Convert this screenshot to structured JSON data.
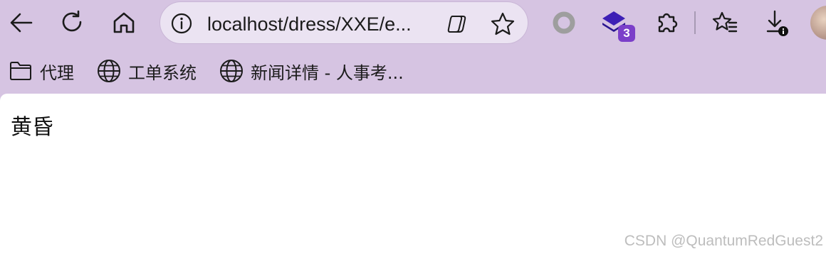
{
  "toolbar": {
    "back": "back-arrow-icon",
    "refresh": "refresh-icon",
    "home": "home-icon",
    "address": {
      "url": "localhost/dress/XXE/e...",
      "info_icon": "info-icon",
      "copilot_icon": "copilot-icon",
      "favorite_icon": "star-icon"
    },
    "extensions": {
      "ring": "ring-extension-icon",
      "layers": "layers-extension-icon",
      "layers_badge": "3",
      "puzzle": "extensions-puzzle-icon"
    },
    "favorites": "favorites-list-icon",
    "downloads": "download-icon",
    "profile": "avatar"
  },
  "bookmarks": [
    {
      "label": "代理",
      "icon": "folder-icon"
    },
    {
      "label": "工单系统",
      "icon": "globe-icon"
    },
    {
      "label": "新闻详情 - 人事考...",
      "icon": "globe-icon"
    }
  ],
  "page": {
    "text": "黄昏"
  },
  "watermark": "CSDN @QuantumRedGuest2",
  "colors": {
    "frame": "#d6c4e2",
    "address_bg": "#ebe3f2",
    "badge": "#7b3fc9",
    "content_bg": "#ffffff"
  }
}
